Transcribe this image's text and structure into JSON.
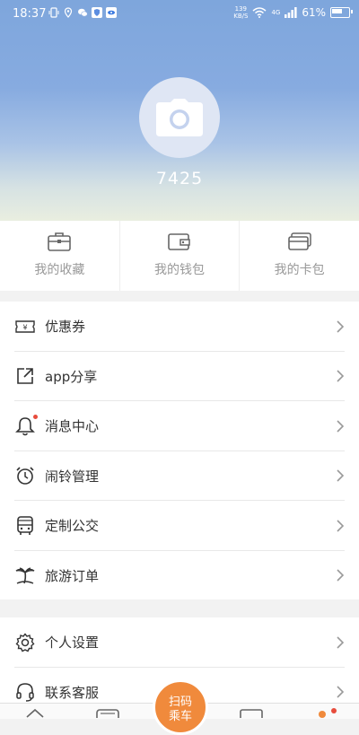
{
  "status_bar": {
    "time": "18:37",
    "network_speed_value": "139",
    "network_speed_unit": "KB/S",
    "signal_label": "4G",
    "battery": "61%"
  },
  "profile": {
    "username": "7425"
  },
  "quick_actions": [
    {
      "label": "我的收藏",
      "icon": "briefcase-icon"
    },
    {
      "label": "我的钱包",
      "icon": "wallet-icon"
    },
    {
      "label": "我的卡包",
      "icon": "cards-icon"
    }
  ],
  "menu_main": [
    {
      "label": "优惠券",
      "icon": "coupon-icon"
    },
    {
      "label": "app分享",
      "icon": "share-icon"
    },
    {
      "label": "消息中心",
      "icon": "bell-icon",
      "badge": true
    },
    {
      "label": "闹铃管理",
      "icon": "alarm-clock-icon"
    },
    {
      "label": "定制公交",
      "icon": "bus-icon"
    },
    {
      "label": "旅游订单",
      "icon": "palm-tree-icon"
    }
  ],
  "menu_secondary": [
    {
      "label": "个人设置",
      "icon": "gear-icon"
    },
    {
      "label": "联系客服",
      "icon": "headset-icon"
    }
  ],
  "bottom_nav": {
    "scan_label": "扫码",
    "scan_label_line2": "乘车"
  },
  "colors": {
    "accent": "#f08a3c",
    "header_top": "#7ea6dc",
    "badge": "#e74c3c"
  }
}
